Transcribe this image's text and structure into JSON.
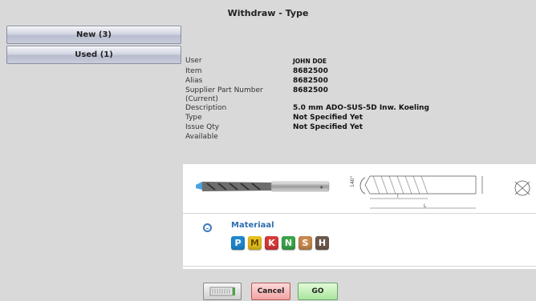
{
  "title": "Withdraw - Type",
  "sidebar": {
    "new_label": "New (3)",
    "used_label": "Used (1)"
  },
  "details": {
    "user": {
      "label": "User",
      "value": "JOHN DOE"
    },
    "item": {
      "label": "Item",
      "value": "8682500"
    },
    "alias": {
      "label": "Alias",
      "value": "8682500"
    },
    "supplier": {
      "label": "Supplier Part Number (Current)",
      "value": "8682500"
    },
    "description": {
      "label": "Description",
      "value": "5.0 mm ADO-SUS-5D Inw. Koeling"
    },
    "type": {
      "label": "Type",
      "value": "Not Specified Yet"
    },
    "issue_qty": {
      "label": "Issue Qty",
      "value": "Not Specified Yet"
    },
    "available": {
      "label": "Available",
      "value": ""
    }
  },
  "diagram": {
    "angle_label": "140°",
    "l_small": "l",
    "l_large": "L"
  },
  "material": {
    "heading": "Materiaal",
    "badges": [
      {
        "letter": "P",
        "color": "#1e88d0"
      },
      {
        "letter": "M",
        "color": "#e8c21a"
      },
      {
        "letter": "K",
        "color": "#d73a3a"
      },
      {
        "letter": "N",
        "color": "#3aa64a"
      },
      {
        "letter": "S",
        "color": "#c8894e"
      },
      {
        "letter": "H",
        "color": "#6e5a4e"
      }
    ]
  },
  "buttons": {
    "cancel_label": "Cancel",
    "go_label": "GO"
  }
}
